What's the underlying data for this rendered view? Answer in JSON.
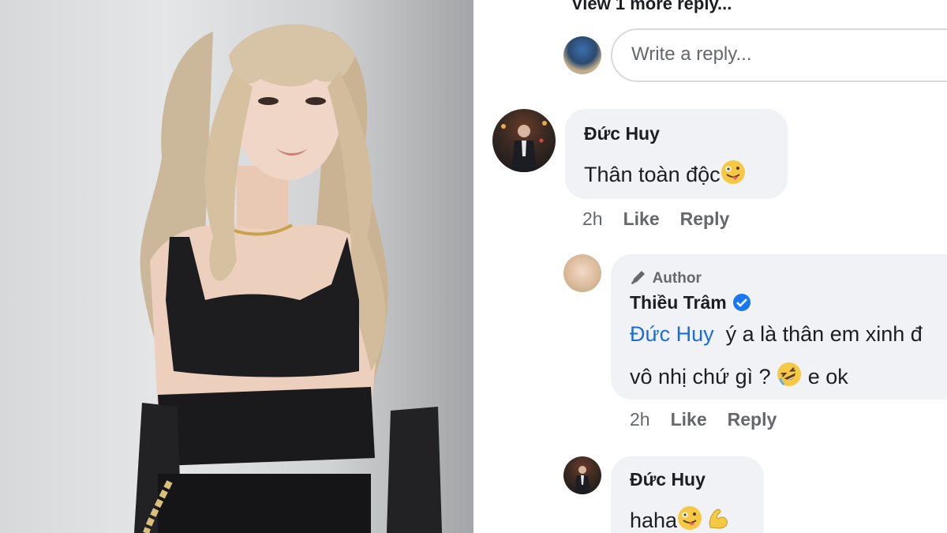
{
  "comments_panel": {
    "view_more_label": "View 1 more reply...",
    "reply_placeholder": "Write a reply...",
    "comment1": {
      "name": "Đức Huy",
      "text": "Thân toàn độc",
      "emoji": "zany-face-emoji",
      "time": "2h",
      "like_label": "Like",
      "reply_label": "Reply"
    },
    "comment2": {
      "author_badge": "Author",
      "name": "Thiều Trâm",
      "mention": "Đức Huy",
      "line1": "ý a là thân em xinh đ",
      "line2": "vô nhị chứ gì ?",
      "line2_suffix": "e ok",
      "emoji": "rofl-emoji",
      "time": "2h",
      "like_label": "Like",
      "reply_label": "Reply"
    },
    "comment3": {
      "name": "Đức Huy",
      "text": "haha",
      "emojis": [
        "zany-face-emoji",
        "flexed-biceps-emoji"
      ]
    }
  },
  "colors": {
    "bubble": "#f0f2f5",
    "mention": "#1a6ed8",
    "verified": "#1877f2",
    "meta": "#65676b"
  }
}
